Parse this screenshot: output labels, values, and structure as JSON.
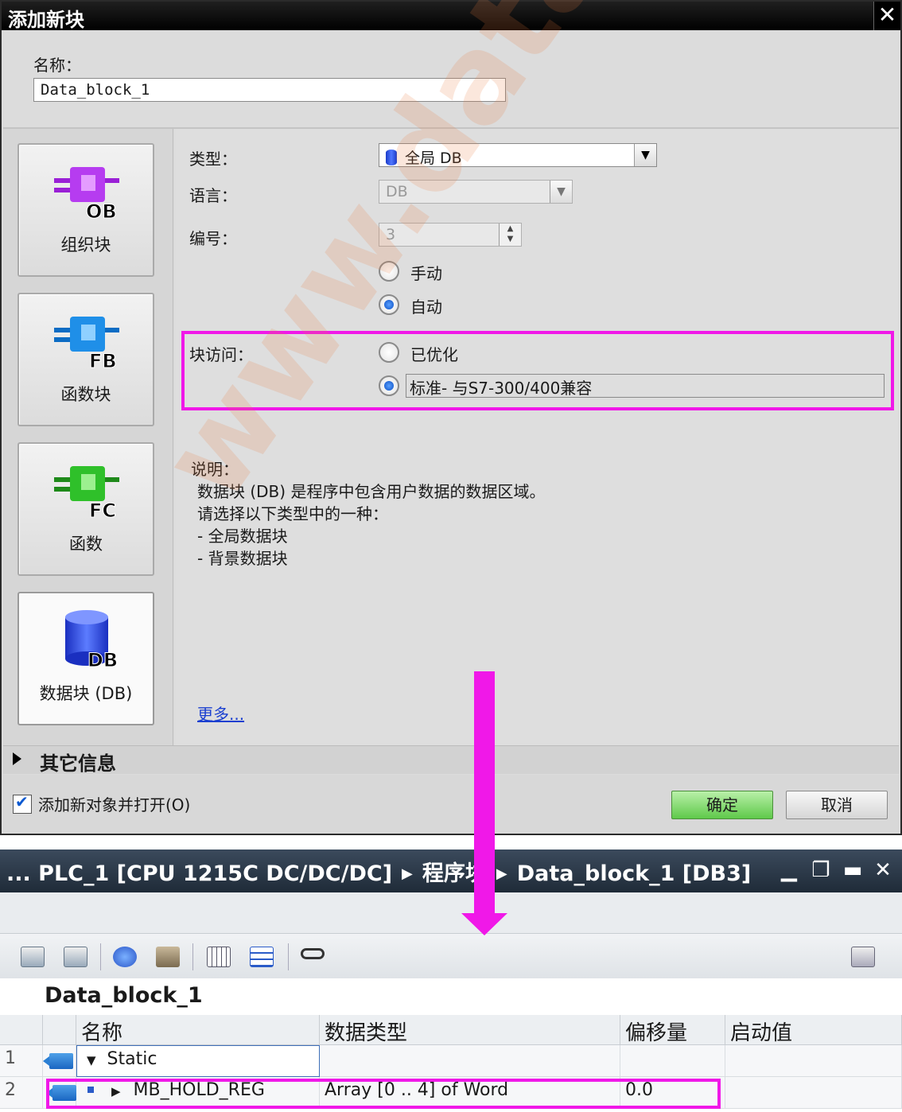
{
  "dialog": {
    "title": "添加新块",
    "close_glyph": "✕",
    "name_label": "名称：",
    "name_value": "Data_block_1",
    "blocks": [
      {
        "badge": "OB",
        "label": "组织块",
        "color": "#b63cf0"
      },
      {
        "badge": "FB",
        "label": "函数块",
        "color": "#1f8fe8"
      },
      {
        "badge": "FC",
        "label": "函数",
        "color": "#2fc02a"
      },
      {
        "badge": "DB",
        "label": "数据块 (DB)",
        "color": "#2346e0"
      }
    ],
    "type_label": "类型：",
    "type_value": "全局 DB",
    "language_label": "语言：",
    "language_value": "DB",
    "number_label": "编号：",
    "number_value": "3",
    "radio_manual": "手动",
    "radio_auto": "自动",
    "access_label": "块访问：",
    "radio_optimized": "已优化",
    "radio_standard": "标准- 与S7-300/400兼容",
    "desc_label": "说明：",
    "desc_lines": [
      "数据块 (DB) 是程序中包含用户数据的数据区域。",
      "请选择以下类型中的一种：",
      "- 全局数据块",
      "- 背景数据块"
    ],
    "more_link": "更多...",
    "more_info": "其它信息",
    "add_open_label": "添加新对象并打开(O)",
    "ok_label": "确定",
    "cancel_label": "取消",
    "highlight_color": "#f018e8"
  },
  "editor": {
    "crumb_1": "... PLC_1 [CPU 1215C DC/DC/DC]",
    "crumb_2": "程序块",
    "crumb_3": "Data_block_1 [DB3]",
    "crumb_sep": "▶",
    "win_min": "▁",
    "win_restore": "❐",
    "win_max": "▬",
    "win_close": "✕",
    "db_name": "Data_block_1",
    "columns": [
      "名称",
      "数据类型",
      "偏移量",
      "启动值"
    ],
    "rows": [
      {
        "no": "1",
        "expander": "▼",
        "name": "Static",
        "type": "",
        "offset": "",
        "start": ""
      },
      {
        "no": "2",
        "expander": "▶",
        "name": "MB_HOLD_REG",
        "type": "Array [0 .. 4] of Word",
        "offset": "0.0",
        "start": ""
      }
    ],
    "toolbar_icons": [
      "insert-row-icon",
      "add-row-icon",
      "snapshot-icon",
      "copy-snapshot-icon",
      "table-view-icon",
      "list-view-icon",
      "monitor-glasses-icon",
      "lock-settings-icon"
    ]
  },
  "watermark": "www.datale.com"
}
